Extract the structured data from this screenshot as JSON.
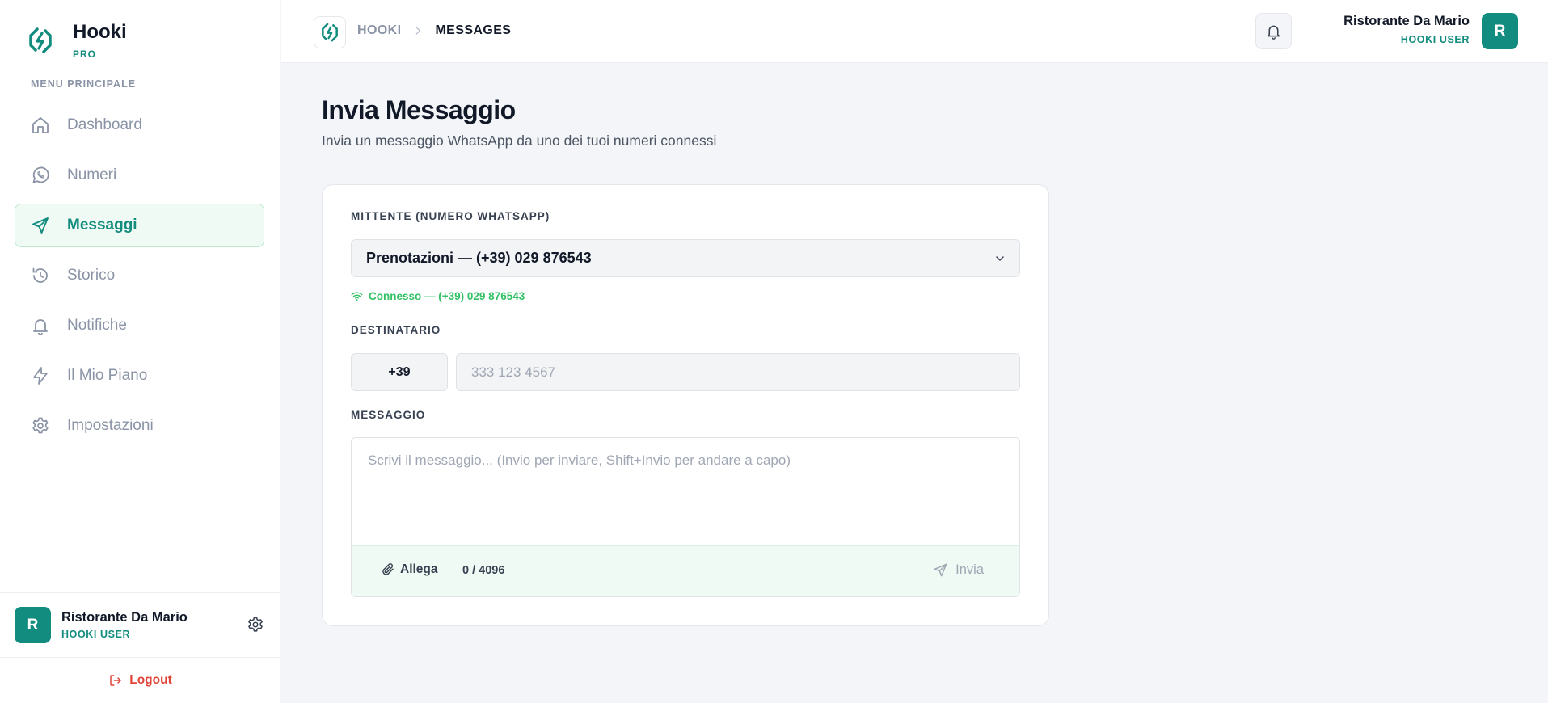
{
  "colors": {
    "brand": "#128c7e",
    "active_bg": "#eefaf3",
    "connected": "#34c166",
    "logout": "#e0453a",
    "muted": "#8a94a6"
  },
  "sidebar": {
    "brand_name": "Hooki",
    "brand_tier": "PRO",
    "menu_title": "MENU PRINCIPALE",
    "items": [
      {
        "label": "Dashboard",
        "icon": "home-icon",
        "active": false
      },
      {
        "label": "Numeri",
        "icon": "whatsapp-icon",
        "active": false
      },
      {
        "label": "Messaggi",
        "icon": "send-icon",
        "active": true
      },
      {
        "label": "Storico",
        "icon": "history-icon",
        "active": false
      },
      {
        "label": "Notifiche",
        "icon": "bell-icon",
        "active": false
      },
      {
        "label": "Il Mio Piano",
        "icon": "lightning-icon",
        "active": false
      },
      {
        "label": "Impostazioni",
        "icon": "gear-icon",
        "active": false
      }
    ],
    "user": {
      "avatar_letter": "R",
      "name": "Ristorante Da Mario",
      "role": "HOOKI USER"
    },
    "logout_label": "Logout"
  },
  "header": {
    "breadcrumb_home": "HOOKI",
    "breadcrumb_current": "MESSAGES",
    "user": {
      "name": "Ristorante Da Mario",
      "role": "HOOKI USER",
      "avatar_letter": "R"
    }
  },
  "main": {
    "title": "Invia Messaggio",
    "subtitle": "Invia un messaggio WhatsApp da uno dei tuoi numeri connessi",
    "form": {
      "sender_label": "MITTENTE (NUMERO WHATSAPP)",
      "sender_selected": "Prenotazioni — (+39) 029 876543",
      "connection_status": "Connesso — (+39) 029 876543",
      "recipient_label": "DESTINATARIO",
      "country_prefix": "+39",
      "phone_placeholder": "333 123 4567",
      "phone_value": "",
      "message_label": "MESSAGGIO",
      "message_placeholder": "Scrivi il messaggio... (Invio per inviare, Shift+Invio per andare a capo)",
      "message_value": "",
      "attach_label": "Allega",
      "char_counter": "0 / 4096",
      "send_label": "Invia"
    }
  }
}
